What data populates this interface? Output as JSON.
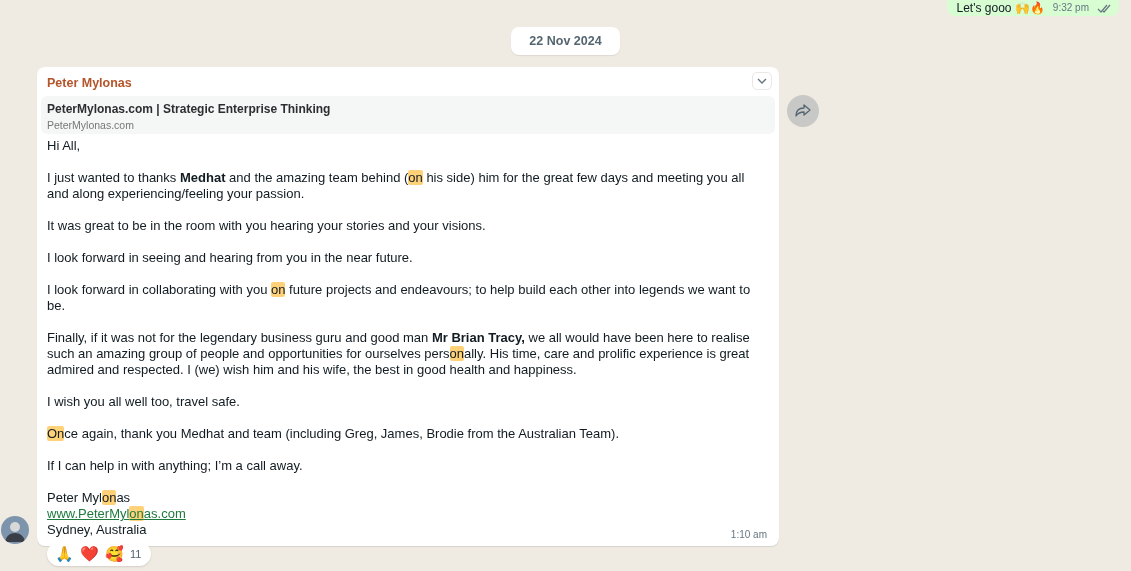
{
  "previous_message": {
    "text": "Let's gooo 🙌🔥",
    "time": "9:32 pm"
  },
  "date_divider": "22 Nov 2024",
  "message": {
    "sender": "Peter Mylonas",
    "link_preview": {
      "title": "PeterMylonas.com | Strategic Enterprise Thinking",
      "domain": "PeterMylonas.com"
    },
    "paragraphs": [
      [
        {
          "kind": "plain",
          "text": "Hi All,"
        }
      ],
      [
        {
          "kind": "plain",
          "text": "I just wanted to thanks "
        },
        {
          "kind": "bold",
          "text": "Medhat"
        },
        {
          "kind": "plain",
          "text": " and the amazing team behind ("
        },
        {
          "kind": "highlight",
          "text": "on"
        },
        {
          "kind": "plain",
          "text": " his side) him for the great few days and meeting you all and along experiencing/feeling your passion."
        }
      ],
      [
        {
          "kind": "plain",
          "text": "It was great to be in the room with you hearing your stories and your visions."
        }
      ],
      [
        {
          "kind": "plain",
          "text": "I look forward in seeing and hearing from you in the near future."
        }
      ],
      [
        {
          "kind": "plain",
          "text": "I look forward in collaborating with you "
        },
        {
          "kind": "highlight",
          "text": "on"
        },
        {
          "kind": "plain",
          "text": " future projects and endeavours; to help build each other into legends we want to be."
        }
      ],
      [
        {
          "kind": "plain",
          "text": "Finally, if it was not for the legendary business guru and good man "
        },
        {
          "kind": "bold",
          "text": "Mr Brian Tracy,"
        },
        {
          "kind": "plain",
          "text": " we all would have been here to realise such an amazing group of people and opportunities for ourselves pers"
        },
        {
          "kind": "highlight",
          "text": "on"
        },
        {
          "kind": "plain",
          "text": "ally. His time, care and prolific experience is great admired and respected. I (we) wish him and his wife, the best in good health and happiness."
        }
      ],
      [
        {
          "kind": "plain",
          "text": "I wish you all well too, travel safe."
        }
      ],
      [
        {
          "kind": "highlight",
          "text": "On"
        },
        {
          "kind": "plain",
          "text": "ce again, thank you Medhat and team (including Greg, James, Brodie from the Australian Team)."
        }
      ],
      [
        {
          "kind": "plain",
          "text": "If I can help in with anything; I’m a call away."
        }
      ]
    ],
    "signature": [
      [
        {
          "kind": "plain",
          "text": "Peter Myl"
        },
        {
          "kind": "highlight",
          "text": "on"
        },
        {
          "kind": "plain",
          "text": "as"
        }
      ],
      [
        {
          "kind": "link",
          "text": "www.PeterMyl"
        },
        {
          "kind": "linkhighlight",
          "text": "on"
        },
        {
          "kind": "link",
          "text": "as.com"
        }
      ],
      [
        {
          "kind": "plain",
          "text": "Sydney, Australia"
        }
      ]
    ],
    "time": "1:10 am",
    "reactions": [
      "🙏",
      "❤️",
      "🥰"
    ],
    "reaction_count": "11"
  }
}
